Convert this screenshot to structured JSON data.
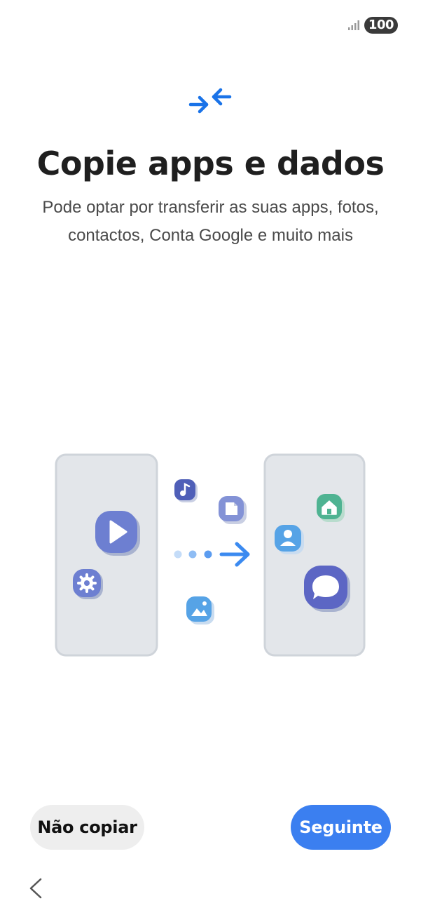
{
  "status_bar": {
    "signal_icon": "signal-bars-icon",
    "battery_level": "100"
  },
  "header": {
    "icon": "transfer-arrows-icon",
    "title": "Copie apps e dados",
    "subtitle": "Pode optar por transferir as suas apps, fotos, contactos, Conta Google e muito mais"
  },
  "illustration": {
    "source_device_icons": [
      "play-icon",
      "settings-icon"
    ],
    "transfer_icons": [
      "music-note-icon",
      "document-icon",
      "image-icon"
    ],
    "target_device_icons": [
      "home-icon",
      "contact-icon",
      "chat-bubble-icon"
    ],
    "colors": {
      "phone_fill": "#e3e6ea",
      "arrow_blue": "#3b8af0",
      "purple": "#6d7fd1",
      "green": "#4fb392",
      "light_blue": "#56a3e6"
    }
  },
  "buttons": {
    "skip_label": "Não copiar",
    "next_label": "Seguinte"
  },
  "navigation": {
    "back_icon": "back-chevron-icon"
  },
  "colors": {
    "primary": "#3b7ff0",
    "secondary_bg": "#eeeeee",
    "accent_icon": "#1a73e8"
  }
}
